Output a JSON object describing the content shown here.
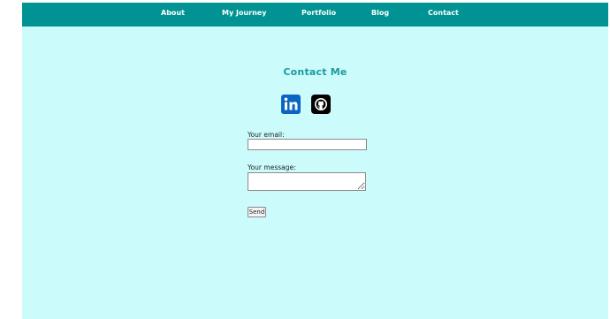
{
  "nav": {
    "items": [
      "About",
      "My Journey",
      "Portfolio",
      "Blog",
      "Contact"
    ]
  },
  "contact": {
    "title": "Contact Me",
    "email_label": "Your email:",
    "email_value": "",
    "message_label": "Your message:",
    "message_value": "",
    "send_label": "Send"
  },
  "social": {
    "icons": [
      "linkedin-icon",
      "github-icon"
    ]
  },
  "colors": {
    "nav_background": "#019393",
    "page_background": "#ccfbfc",
    "title": "#1a9c9c",
    "linkedin": "#0a66c2",
    "github": "#000000"
  }
}
